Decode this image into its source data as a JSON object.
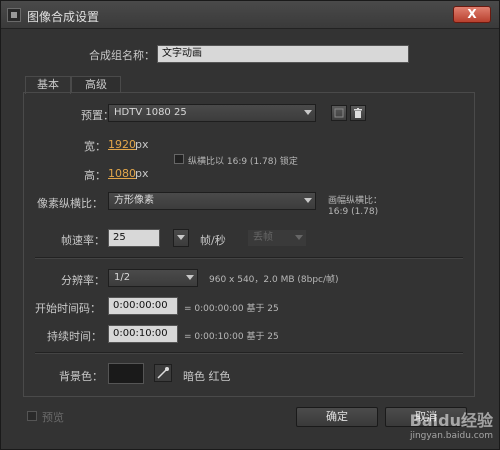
{
  "window": {
    "title": "图像合成设置",
    "close_label": "X"
  },
  "comp_name": {
    "label": "合成组名称：",
    "value": "文字动画"
  },
  "tabs": [
    {
      "label": "基本"
    },
    {
      "label": "高级"
    }
  ],
  "preset": {
    "label": "预置：",
    "value": "HDTV 1080 25"
  },
  "width": {
    "label": "宽：",
    "value": "1920",
    "unit": "px"
  },
  "height": {
    "label": "高：",
    "value": "1080",
    "unit": "px"
  },
  "aspect_lock": {
    "label": "纵横比以 16:9 (1.78) 锁定",
    "checked": false
  },
  "pixel_aspect": {
    "label": "像素纵横比：",
    "value": "方形像素",
    "frame_aspect_label": "画幅纵横比：",
    "frame_aspect_value": "16:9 (1.78)"
  },
  "frame_rate": {
    "label": "帧速率：",
    "value": "25",
    "unit": "帧/秒",
    "drop_frame": "丢帧"
  },
  "resolution": {
    "label": "分辨率：",
    "value": "1/2",
    "info": "960 x 540，2.0 MB (8bpc/帧)"
  },
  "start_timecode": {
    "label": "开始时间码：",
    "value": "0:00:00:00",
    "info": "= 0:00:00:00  基于 25"
  },
  "duration": {
    "label": "持续时间：",
    "value": "0:00:10:00",
    "info": "= 0:00:10:00  基于 25"
  },
  "background": {
    "label": "背景色：",
    "color_name": "暗色 红色",
    "swatch_color": "#1a1a1a"
  },
  "preview": {
    "label": "预览",
    "checked": false
  },
  "buttons": {
    "ok": "确定",
    "cancel": "取消"
  },
  "watermark": {
    "brand": "Baidu经验",
    "url": "jingyan.baidu.com"
  }
}
